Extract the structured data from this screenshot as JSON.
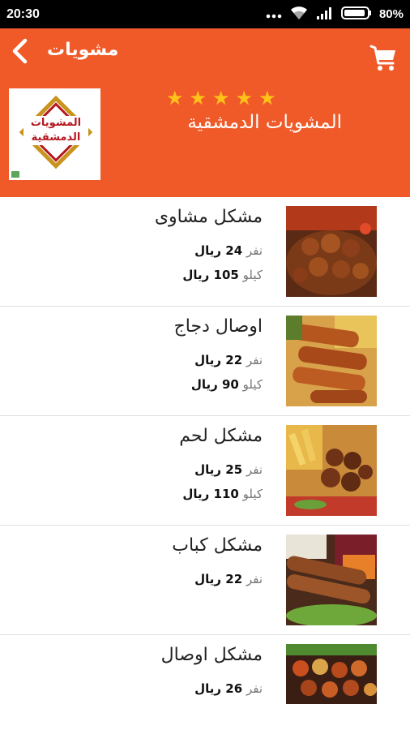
{
  "status_bar": {
    "time": "20:30",
    "battery": "80%"
  },
  "header": {
    "title": "مشويات",
    "restaurant_name": "المشويات الدمشقية",
    "rating_stars": 5,
    "logo_text": "المشويات الدمشقية"
  },
  "colors": {
    "brand": "#f05a28",
    "star": "#ffc21a"
  },
  "menu_items": [
    {
      "name": "مشكل مشاوى",
      "prices": [
        {
          "unit": "نفر",
          "amount": "24 ريال"
        },
        {
          "unit": "كيلو",
          "amount": "105 ريال"
        }
      ]
    },
    {
      "name": "اوصال دجاج",
      "prices": [
        {
          "unit": "نفر",
          "amount": "22 ريال"
        },
        {
          "unit": "كيلو",
          "amount": "90 ريال"
        }
      ]
    },
    {
      "name": "مشكل لحم",
      "prices": [
        {
          "unit": "نفر",
          "amount": "25 ريال"
        },
        {
          "unit": "كيلو",
          "amount": "110 ريال"
        }
      ]
    },
    {
      "name": "مشكل كباب",
      "prices": [
        {
          "unit": "نفر",
          "amount": "22 ريال"
        }
      ]
    },
    {
      "name": "مشكل اوصال",
      "prices": [
        {
          "unit": "نفر",
          "amount": "26 ريال"
        }
      ]
    }
  ]
}
